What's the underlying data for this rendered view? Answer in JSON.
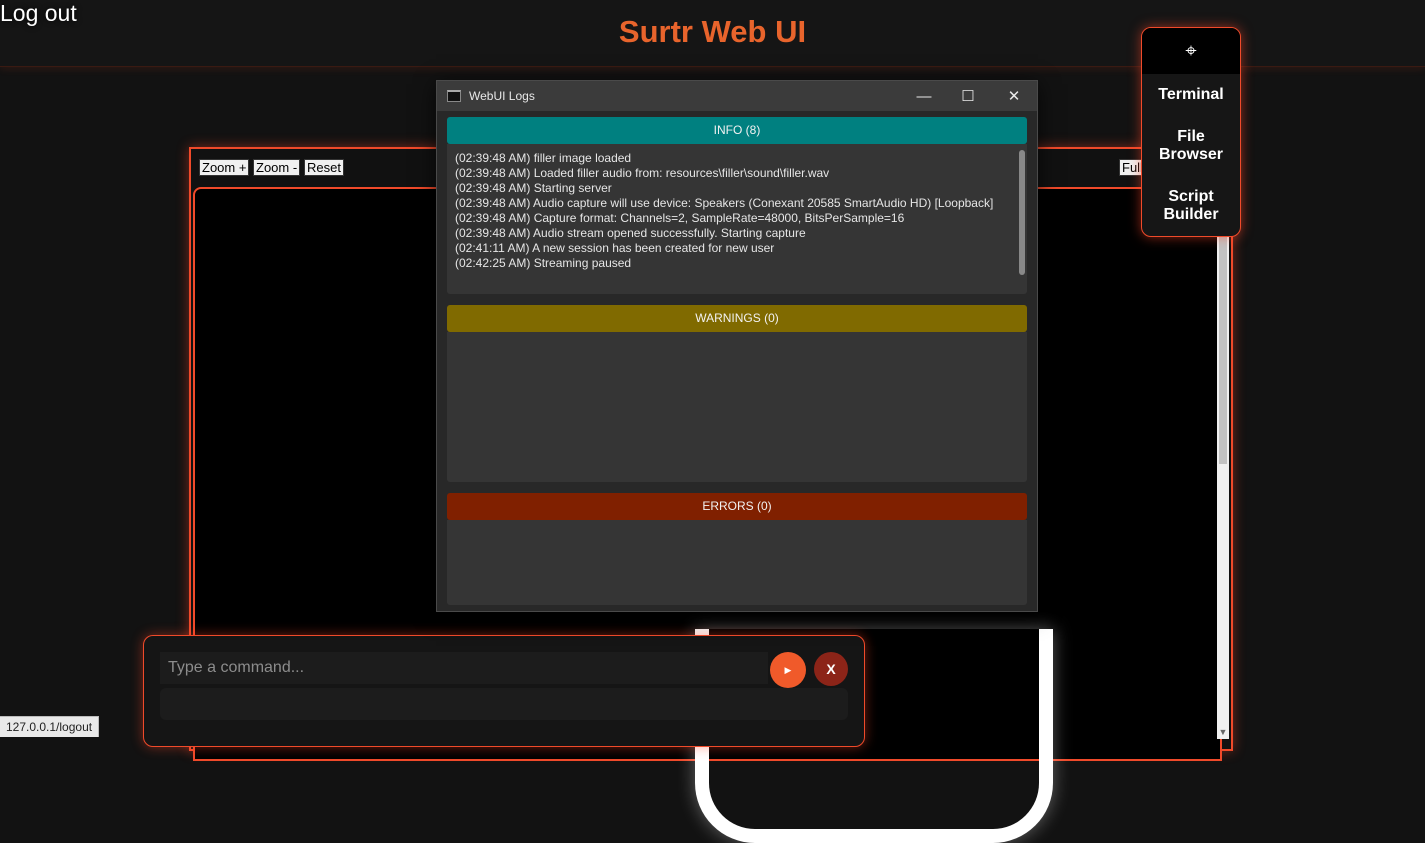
{
  "header": {
    "logout_label": "Log out",
    "title": "Surtr Web UI",
    "title_color": "#e8642c"
  },
  "viewer": {
    "zoom_in_label": "Zoom +",
    "zoom_out_label": "Zoom -",
    "reset_label": "Reset",
    "fullscreen_label": "Fullscreen"
  },
  "side_menu": {
    "top_icon": "crosshair-icon",
    "items": [
      {
        "label": "Terminal"
      },
      {
        "label": "File Browser"
      },
      {
        "label": "Script Builder"
      }
    ]
  },
  "log_window": {
    "title": "WebUI Logs",
    "controls": {
      "minimize": "—",
      "maximize": "☐",
      "close": "✕"
    },
    "info": {
      "label": "INFO (8)",
      "color": "#008080",
      "lines": [
        "(02:39:48 AM) filler image loaded",
        "(02:39:48 AM) Loaded filler audio from: resources\\filler\\sound\\filler.wav",
        "(02:39:48 AM) Starting server",
        "(02:39:48 AM) Audio capture will use device: Speakers (Conexant 20585 SmartAudio HD) [Loopback]",
        "(02:39:48 AM) Capture format: Channels=2, SampleRate=48000, BitsPerSample=16",
        "(02:39:48 AM) Audio stream opened successfully. Starting capture",
        "(02:41:11 AM) A new session has been created for new user",
        "(02:42:25 AM) Streaming paused"
      ]
    },
    "warnings": {
      "label": "WARNINGS (0)",
      "color": "#806a00"
    },
    "errors": {
      "label": "ERRORS (0)",
      "color": "#802000"
    }
  },
  "command": {
    "placeholder": "Type a command...",
    "send_icon": "play-icon",
    "send_glyph": "▶",
    "close_label": "X"
  },
  "status_bar": {
    "url": "127.0.0.1/logout"
  }
}
